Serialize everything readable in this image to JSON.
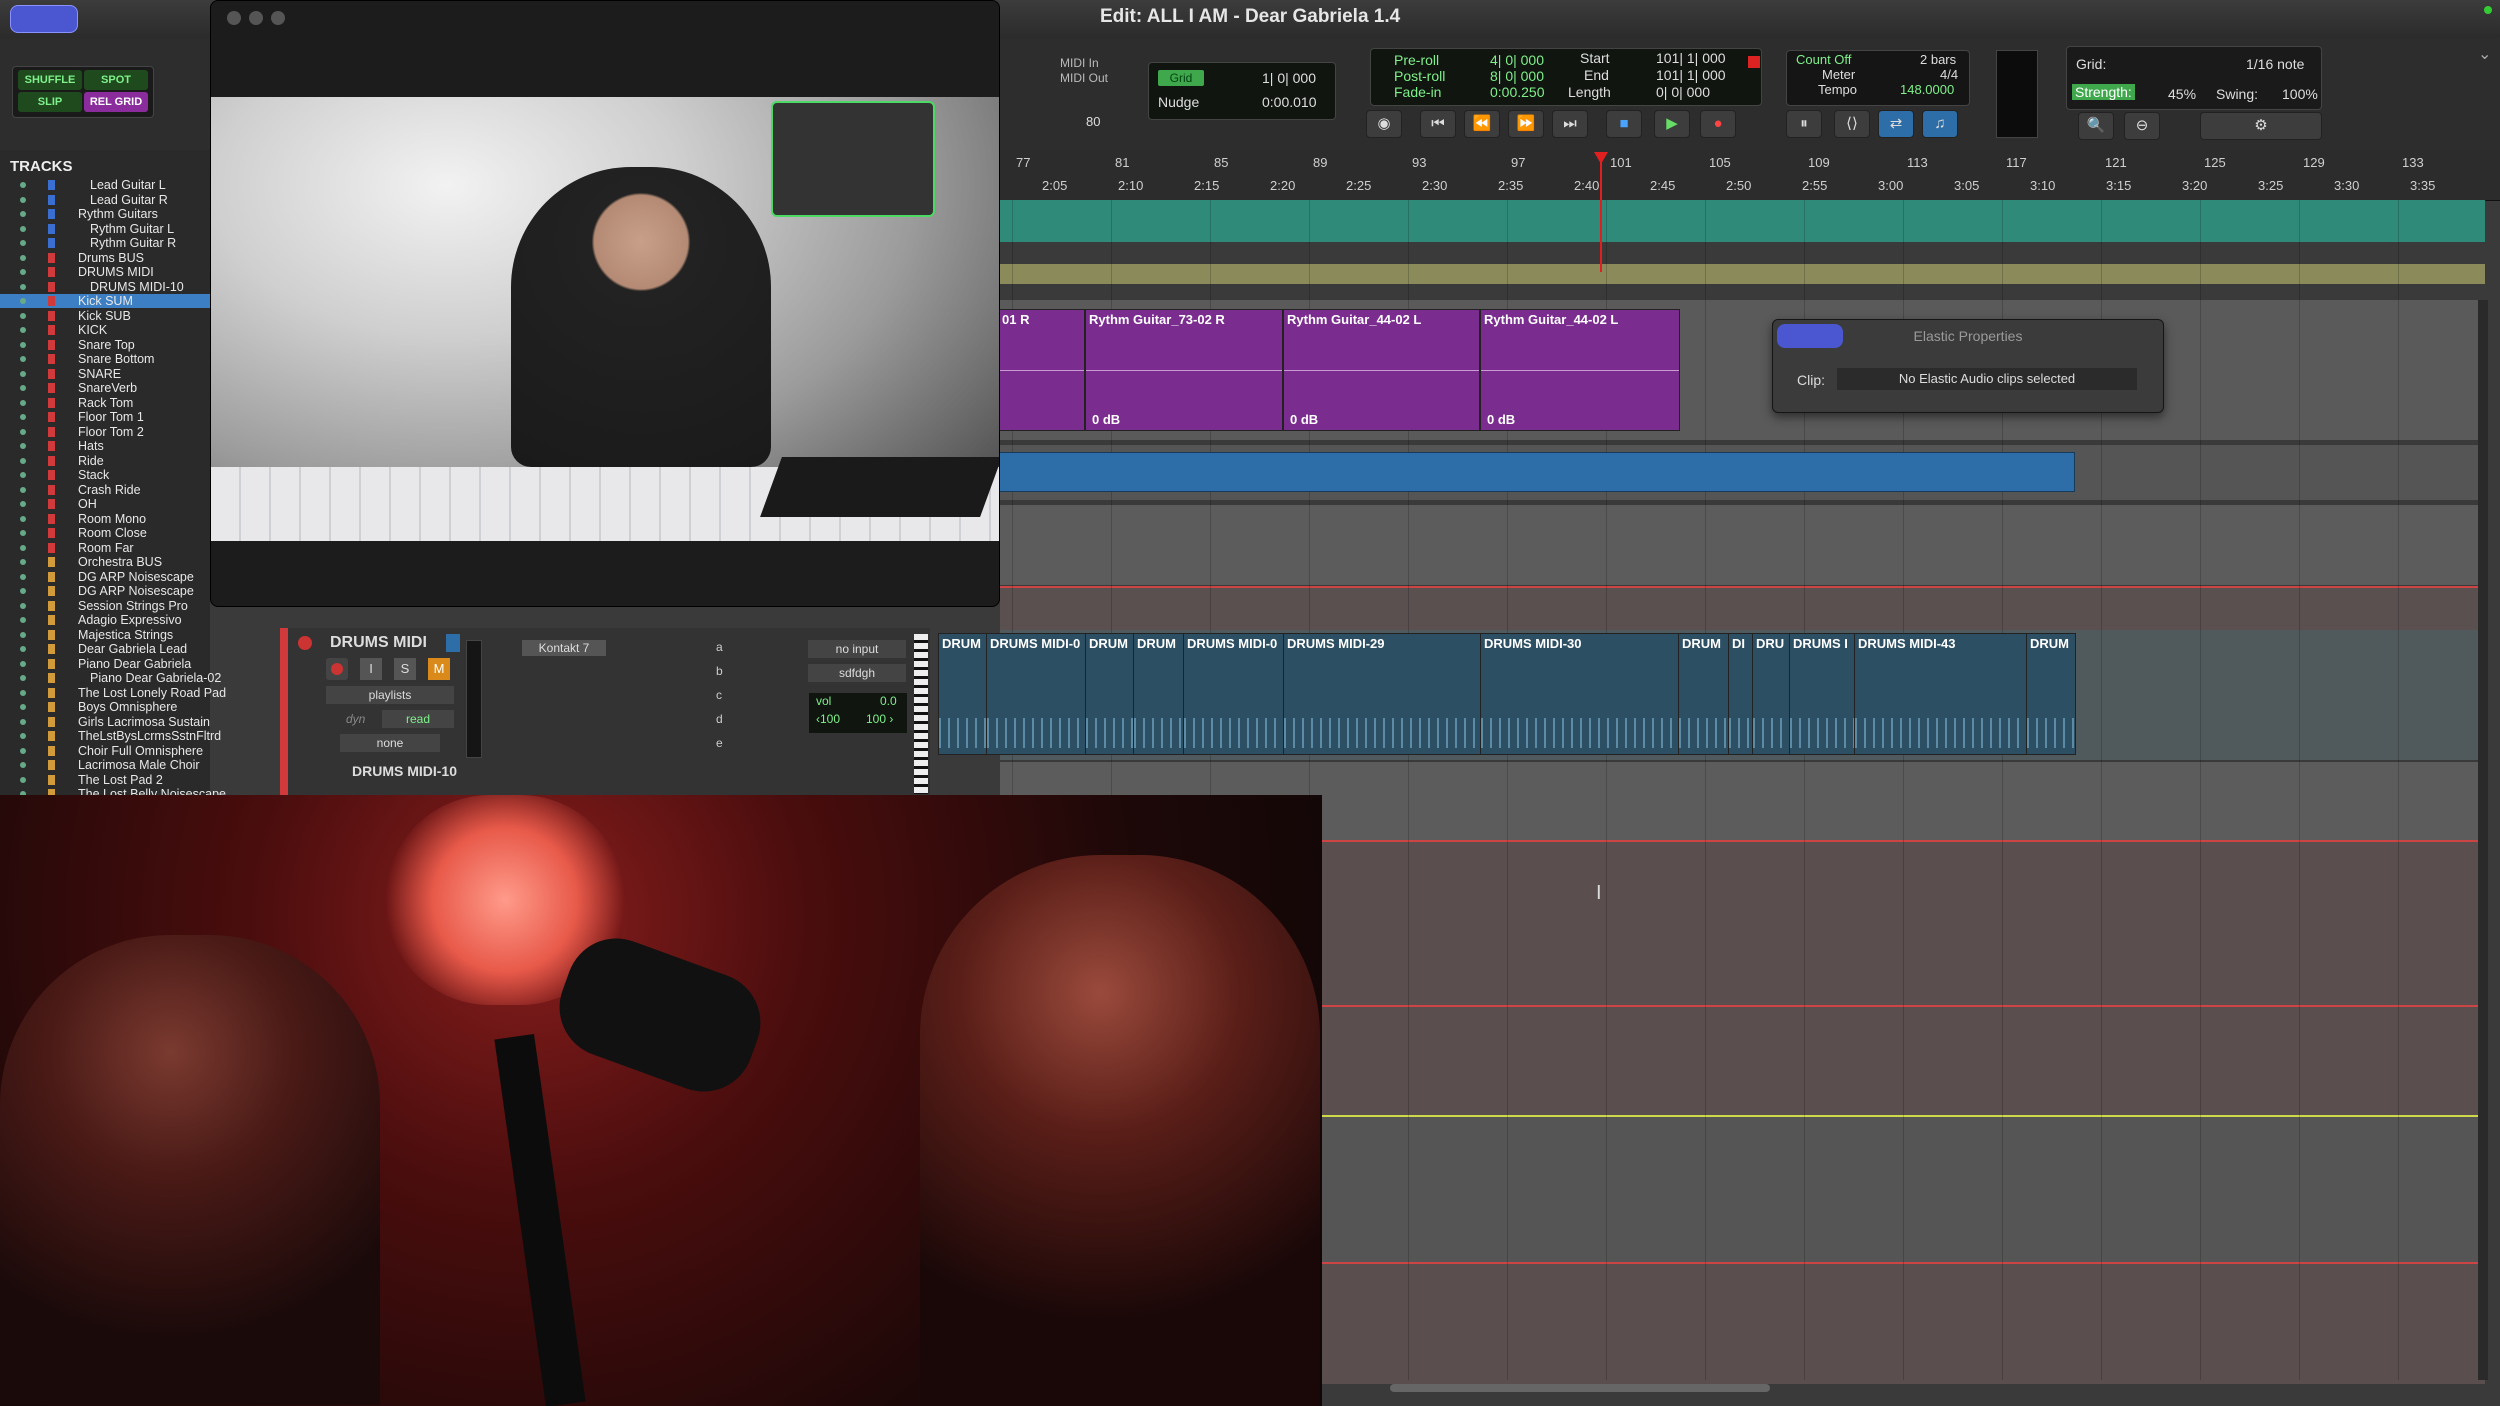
{
  "window": {
    "title": "Edit: ALL I AM - Dear Gabriela 1.4"
  },
  "edit_modes": {
    "shuffle": "SHUFFLE",
    "spot": "SPOT",
    "slip": "SLIP",
    "grid": "REL GRID"
  },
  "midi": {
    "in": "MIDI In",
    "out": "MIDI Out",
    "value": "80"
  },
  "grid_nudge": {
    "grid_label": "Grid",
    "grid_value": "1| 0| 000",
    "nudge_label": "Nudge",
    "nudge_value": "0:00.010"
  },
  "preroll": {
    "pre_label": "Pre-roll",
    "pre_value": "4| 0| 000",
    "post_label": "Post-roll",
    "post_value": "8| 0| 000",
    "fade_label": "Fade-in",
    "fade_value": "0:00.250"
  },
  "selection": {
    "start_label": "Start",
    "start_value": "101| 1| 000",
    "end_label": "End",
    "end_value": "101| 1| 000",
    "length_label": "Length",
    "length_value": "0| 0| 000"
  },
  "counter": {
    "count_off": "Count Off",
    "bars": "2 bars",
    "meter_label": "Meter",
    "meter_value": "4/4",
    "tempo_label": "Tempo",
    "tempo_value": "148.0000"
  },
  "quantize": {
    "grid_label": "Grid:",
    "grid_value": "1/16 note",
    "strength_label": "Strength:",
    "strength_value": "45%",
    "swing_label": "Swing:",
    "swing_value": "100%"
  },
  "tracks": {
    "header": "TRACKS",
    "items": [
      {
        "name": "Lead Guitar L",
        "color": "#3a6fd1",
        "indent": 1
      },
      {
        "name": "Lead Guitar R",
        "color": "#3a6fd1",
        "indent": 1
      },
      {
        "name": "Rythm Guitars",
        "color": "#3a6fd1",
        "indent": 0
      },
      {
        "name": "Rythm Guitar L",
        "color": "#3a6fd1",
        "indent": 1
      },
      {
        "name": "Rythm Guitar R",
        "color": "#3a6fd1",
        "indent": 1
      },
      {
        "name": "Drums BUS",
        "color": "#d13a3a",
        "indent": 0
      },
      {
        "name": "DRUMS MIDI",
        "color": "#d13a3a",
        "indent": 0
      },
      {
        "name": "DRUMS MIDI-10",
        "color": "#d13a3a",
        "indent": 1
      },
      {
        "name": "Kick SUM",
        "color": "#d13a3a",
        "indent": 0,
        "selected": true
      },
      {
        "name": "Kick SUB",
        "color": "#d13a3a",
        "indent": 0
      },
      {
        "name": "KICK",
        "color": "#d13a3a",
        "indent": 0
      },
      {
        "name": "Snare Top",
        "color": "#d13a3a",
        "indent": 0
      },
      {
        "name": "Snare Bottom",
        "color": "#d13a3a",
        "indent": 0
      },
      {
        "name": "SNARE",
        "color": "#d13a3a",
        "indent": 0
      },
      {
        "name": "SnareVerb",
        "color": "#d13a3a",
        "indent": 0
      },
      {
        "name": "Rack Tom",
        "color": "#d13a3a",
        "indent": 0
      },
      {
        "name": "Floor Tom 1",
        "color": "#d13a3a",
        "indent": 0
      },
      {
        "name": "Floor Tom 2",
        "color": "#d13a3a",
        "indent": 0
      },
      {
        "name": "Hats",
        "color": "#d13a3a",
        "indent": 0
      },
      {
        "name": "Ride",
        "color": "#d13a3a",
        "indent": 0
      },
      {
        "name": "Stack",
        "color": "#d13a3a",
        "indent": 0
      },
      {
        "name": "Crash Ride",
        "color": "#d13a3a",
        "indent": 0
      },
      {
        "name": "OH",
        "color": "#d13a3a",
        "indent": 0
      },
      {
        "name": "Room Mono",
        "color": "#d13a3a",
        "indent": 0
      },
      {
        "name": "Room Close",
        "color": "#d13a3a",
        "indent": 0
      },
      {
        "name": "Room Far",
        "color": "#d13a3a",
        "indent": 0
      },
      {
        "name": "Orchestra BUS",
        "color": "#d19a3a",
        "indent": 0
      },
      {
        "name": "DG ARP Noisescape",
        "color": "#d19a3a",
        "indent": 0
      },
      {
        "name": "DG ARP Noisescape",
        "color": "#d19a3a",
        "indent": 0
      },
      {
        "name": "Session Strings Pro",
        "color": "#d19a3a",
        "indent": 0
      },
      {
        "name": "Adagio Expressivo",
        "color": "#d19a3a",
        "indent": 0
      },
      {
        "name": "Majestica Strings",
        "color": "#d19a3a",
        "indent": 0
      },
      {
        "name": "Dear Gabriela Lead",
        "color": "#d19a3a",
        "indent": 0
      },
      {
        "name": "Piano Dear Gabriela",
        "color": "#d19a3a",
        "indent": 0
      },
      {
        "name": "Piano Dear Gabriela-02",
        "color": "#d19a3a",
        "indent": 1
      },
      {
        "name": "The Lost Lonely Road Pad",
        "color": "#d19a3a",
        "indent": 0
      },
      {
        "name": "Boys Omnisphere",
        "color": "#d19a3a",
        "indent": 0
      },
      {
        "name": "Girls Lacrimosa Sustain",
        "color": "#d19a3a",
        "indent": 0
      },
      {
        "name": "TheLstBysLcrmsSstnFltrd",
        "color": "#d19a3a",
        "indent": 0
      },
      {
        "name": "Choir Full Omnisphere",
        "color": "#d19a3a",
        "indent": 0
      },
      {
        "name": "Lacrimosa Male Choir",
        "color": "#d19a3a",
        "indent": 0
      },
      {
        "name": "The Lost Pad 2",
        "color": "#d19a3a",
        "indent": 0
      },
      {
        "name": "The Lost Belly Noisescape",
        "color": "#d19a3a",
        "indent": 0
      }
    ]
  },
  "ruler": {
    "bars": [
      "77",
      "81",
      "85",
      "89",
      "93",
      "97",
      "101",
      "105",
      "109",
      "113",
      "117",
      "121",
      "125",
      "129",
      "133"
    ],
    "times": [
      "2:05",
      "2:10",
      "2:15",
      "2:20",
      "2:25",
      "2:30",
      "2:35",
      "2:40",
      "2:45",
      "2:50",
      "2:55",
      "3:00",
      "3:05",
      "3:10",
      "3:15",
      "3:20",
      "3:25",
      "3:30",
      "3:35"
    ]
  },
  "guitar_clips": [
    {
      "name": "01 R",
      "gain": ""
    },
    {
      "name": "Rythm Guitar_73-02 R",
      "gain": "0 dB"
    },
    {
      "name": "Rythm Guitar_44-02 L",
      "gain": "0 dB"
    },
    {
      "name": "Rythm Guitar_44-02 L",
      "gain": "0 dB"
    }
  ],
  "drum_clips": [
    {
      "name": "DRUM"
    },
    {
      "name": "DRUMS MIDI-0"
    },
    {
      "name": "DRUM"
    },
    {
      "name": "DRUM"
    },
    {
      "name": "DRUMS MIDI-0"
    },
    {
      "name": "DRUMS MIDI-29"
    },
    {
      "name": "DRUMS MIDI-30"
    },
    {
      "name": "DRUM"
    },
    {
      "name": "DI"
    },
    {
      "name": "DRU"
    },
    {
      "name": "DRUMS I"
    },
    {
      "name": "DRUMS MIDI-43"
    },
    {
      "name": "DRUM"
    }
  ],
  "elastic": {
    "title": "Elastic Properties",
    "clip_label": "Clip:",
    "message": "No Elastic Audio clips selected"
  },
  "edit_track": {
    "name": "DRUMS MIDI",
    "playlists": "playlists",
    "dyn": "dyn",
    "automation": "read",
    "group": "none",
    "insert": "Kontakt 7",
    "sends": [
      "a",
      "b",
      "c",
      "d",
      "e"
    ],
    "input": "no input",
    "output": "sdfdgh",
    "vol_label": "vol",
    "vol_value": "0.0",
    "pan_left": "‹100",
    "pan_right": "100 ›",
    "sub_name": "DRUMS MIDI-10",
    "btn_i": "I",
    "btn_s": "S",
    "btn_m": "M"
  },
  "colors": {
    "accent": "#4b56d1",
    "guitar_clip": "#7b2d8f",
    "drum_clip": "#2c4f63",
    "blue_clip": "#2d6ea8",
    "playhead": "#e02020"
  }
}
